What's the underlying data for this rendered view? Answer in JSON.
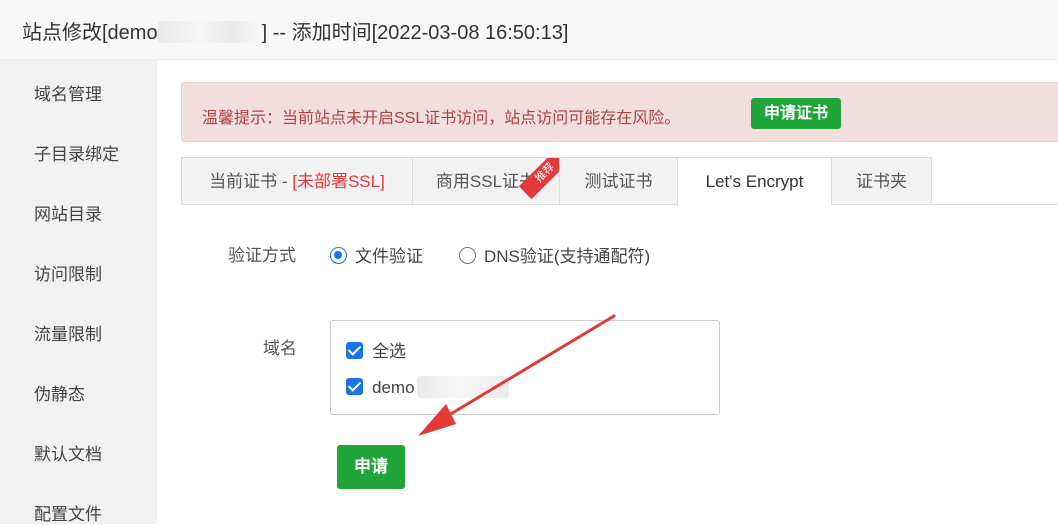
{
  "title": {
    "prefix": "站点修改[demo",
    "suffix": "] -- 添加时间[2022-03-08 16:50:13]"
  },
  "sidebar": {
    "items": [
      "域名管理",
      "子目录绑定",
      "网站目录",
      "访问限制",
      "流量限制",
      "伪静态",
      "默认文档",
      "配置文件"
    ]
  },
  "alert": {
    "message": "温馨提示：当前站点未开启SSL证书访问，站点访问可能存在风险。",
    "button": "申请证书"
  },
  "tabs": {
    "current_prefix": "当前证书 - ",
    "current_status": "[未部署SSL]",
    "commercial": "商用SSL证书",
    "commercial_badge": "推荐",
    "test": "测试证书",
    "letsencrypt": "Let's Encrypt",
    "folder": "证书夹"
  },
  "form": {
    "verify_label": "验证方式",
    "verify_options": [
      "文件验证",
      "DNS验证(支持通配符)"
    ],
    "verify_selected": "文件验证",
    "domain_label": "域名",
    "select_all": "全选",
    "domain_item": "demo",
    "submit": "申请"
  },
  "colors": {
    "accent_green": "#20a53a",
    "alert_text": "#a94442",
    "alert_bg": "#f2dede",
    "checkbox_blue": "#1a73e8",
    "annotation_arrow": "#e53935"
  }
}
